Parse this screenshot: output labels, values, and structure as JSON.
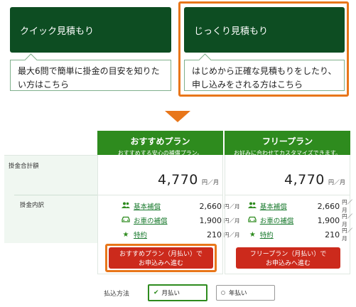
{
  "estimates": {
    "quick": {
      "button": "クイック見積もり",
      "description": "最大6問で簡単に掛金の目安を知りたい方はこちら"
    },
    "detailed": {
      "button": "じっくり見積もり",
      "description": "はじめから正確な見積もりをしたり、申し込みをされる方はこちら"
    }
  },
  "row_labels": {
    "total": "掛金合計額",
    "breakdown": "掛金内訳"
  },
  "plans": [
    {
      "name": "おすすめプラン",
      "subtitle": "おすすめする安心の補償プラン。",
      "total": "4,770",
      "unit": "円／月",
      "items": [
        {
          "icon": "people-icon",
          "label": "基本補償",
          "amount": "2,660",
          "unit": "円／月"
        },
        {
          "icon": "car-icon",
          "label": "お車の補償",
          "amount": "1,900",
          "unit": "円／月"
        },
        {
          "icon": "star-icon",
          "label": "特約",
          "amount": "210",
          "unit": "円／月"
        }
      ],
      "apply_line1": "おすすめプラン（月払い）で",
      "apply_line2": "お申込みへ進む"
    },
    {
      "name": "フリープラン",
      "subtitle": "お好みに合わせてカスタマイズできます。",
      "total": "4,770",
      "unit": "円／月",
      "items": [
        {
          "icon": "people-icon",
          "label": "基本補償",
          "amount": "2,660",
          "unit": "円／月"
        },
        {
          "icon": "car-icon",
          "label": "お車の補償",
          "amount": "1,900",
          "unit": "円／月"
        },
        {
          "icon": "star-icon",
          "label": "特約",
          "amount": "210",
          "unit": "円／月"
        }
      ],
      "apply_line1": "フリープラン（月払い）で",
      "apply_line2": "お申込みへ進む"
    }
  ],
  "payment": {
    "label": "払込方法",
    "options": [
      "月払い",
      "年払い"
    ],
    "selected": "月払い"
  },
  "colors": {
    "dark_green": "#0d4d22",
    "green": "#2e8b1e",
    "orange": "#e8761a",
    "red": "#cc2a1c"
  }
}
